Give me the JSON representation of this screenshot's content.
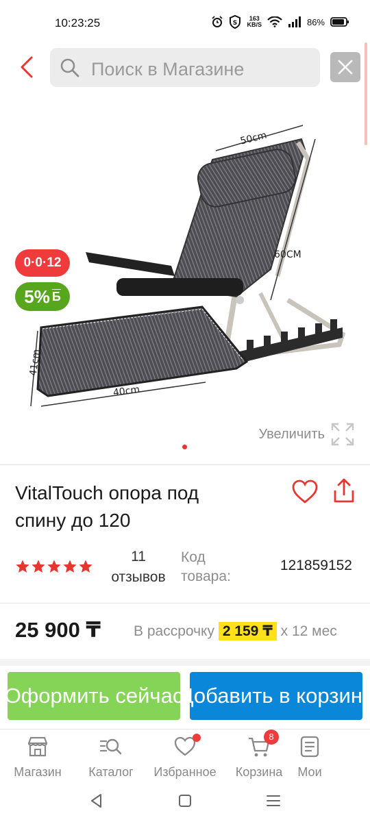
{
  "status_bar": {
    "time": "10:23:25",
    "net_speed_value": "163",
    "net_speed_unit": "KB/S",
    "battery": "86%",
    "icons": [
      "alarm-icon",
      "shield-icon",
      "wifi-icon",
      "signal-icon",
      "battery-icon"
    ]
  },
  "header": {
    "search_placeholder": "Поиск в Магазине",
    "back_icon": "chevron-left-icon",
    "close_icon": "close-icon"
  },
  "gallery": {
    "dimensions": {
      "width_top": "50cm",
      "back_height": "60CM",
      "seat_depth": "41cm",
      "seat_width": "40cm"
    },
    "badge_installment": "0·0·12",
    "badge_bonus": "5%",
    "badge_bonus_symbol": "Б",
    "zoom_label": "Увеличить",
    "current_slide": 1
  },
  "product": {
    "title": "VitalTouch опора под спину до 120",
    "rating_stars": 5,
    "reviews_count": "11",
    "reviews_label": "отзывов",
    "code_label": "Код товара:",
    "code_value": "121859152"
  },
  "price": {
    "value": "25 900 ₸",
    "installment_label": "В рассрочку",
    "installment_monthly": "2 159 ₸",
    "installment_term": "x 12 мес"
  },
  "actions": {
    "buy_now": "Оформить сейчас",
    "add_to_cart": "Добавить в корзину"
  },
  "bottom_nav": [
    {
      "label": "Магазин",
      "icon": "store-icon"
    },
    {
      "label": "Каталог",
      "icon": "catalog-search-icon"
    },
    {
      "label": "Избранное",
      "icon": "heart-icon"
    },
    {
      "label": "Корзина",
      "icon": "cart-icon",
      "badge": "8"
    },
    {
      "label": "Мои",
      "icon": "orders-icon"
    }
  ],
  "colors": {
    "accent_red": "#e5372f",
    "buy_green": "#86d457",
    "cart_blue": "#0a87d8",
    "installment_yellow": "#ffe01b",
    "bonus_green": "#58a51e"
  }
}
